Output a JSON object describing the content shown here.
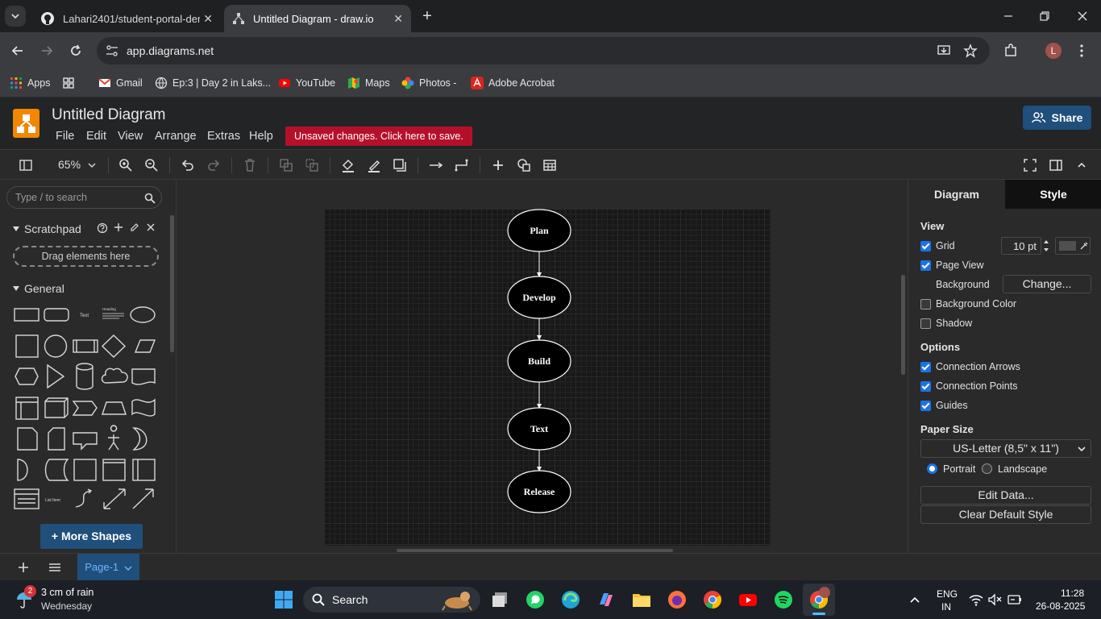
{
  "browser": {
    "tabs": [
      {
        "title": "Lahari2401/student-portal-dem",
        "close": "✕"
      },
      {
        "title": "Untitled Diagram - draw.io",
        "close": "✕"
      }
    ],
    "new_tab": "+",
    "url": "app.diagrams.net",
    "profile_initial": "L",
    "bookmarks": [
      "Apps",
      "Gmail",
      "Ep:3 | Day 2 in Laks...",
      "YouTube",
      "Maps",
      "Photos -",
      "Adobe Acrobat"
    ]
  },
  "app": {
    "title": "Untitled Diagram",
    "menu": [
      "File",
      "Edit",
      "View",
      "Arrange",
      "Extras",
      "Help"
    ],
    "unsaved_notice": "Unsaved changes. Click here to save.",
    "share_label": "Share",
    "zoom": "65%"
  },
  "left_panel": {
    "search_placeholder": "Type / to search",
    "scratchpad_label": "Scratchpad",
    "drag_hint": "Drag elements here",
    "general_label": "General",
    "more_shapes": "+ More Shapes",
    "shape_text": {
      "text": "Text",
      "heading": "Heading",
      "list": "List Item"
    }
  },
  "diagram": {
    "nodes": [
      "Plan",
      "Develop",
      "Build",
      "Text",
      "Release"
    ]
  },
  "right_panel": {
    "tabs": [
      "Diagram",
      "Style"
    ],
    "view_label": "View",
    "grid_label": "Grid",
    "grid_size": "10 pt",
    "page_view_label": "Page View",
    "background_label": "Background",
    "change_button": "Change...",
    "background_color_label": "Background Color",
    "shadow_label": "Shadow",
    "options_label": "Options",
    "connection_arrows": "Connection Arrows",
    "connection_points": "Connection Points",
    "guides": "Guides",
    "paper_size_label": "Paper Size",
    "paper_size": "US-Letter (8,5\" x 11\")",
    "portrait": "Portrait",
    "landscape": "Landscape",
    "edit_data": "Edit Data...",
    "clear_default_style": "Clear Default Style",
    "checks": {
      "grid": true,
      "page_view": true,
      "background_color": false,
      "shadow": false,
      "connection_arrows": true,
      "connection_points": true,
      "guides": true
    },
    "orientation": "portrait"
  },
  "pagebar": {
    "page_label": "Page-1"
  },
  "taskbar": {
    "weather_badge": "2",
    "weather_line1": "3 cm of rain",
    "weather_line2": "Wednesday",
    "search_label": "Search",
    "lang_line1": "ENG",
    "lang_line2": "IN",
    "time": "11:28",
    "date": "26-08-2025"
  },
  "colors": {
    "accent": "#1a73e8",
    "drawio_orange": "#f08705",
    "unsaved_red": "#b5102a",
    "share_blue": "#1f4f7a"
  }
}
